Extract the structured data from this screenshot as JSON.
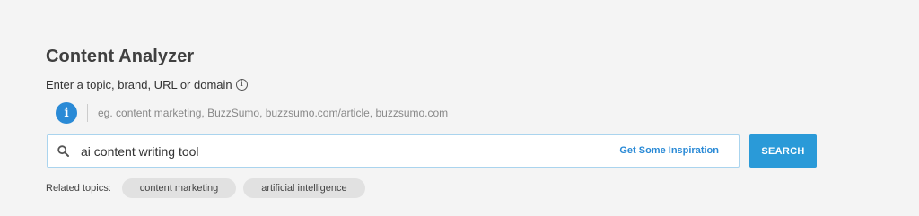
{
  "page": {
    "title": "Content Analyzer",
    "subtitle": "Enter a topic, brand, URL or domain",
    "subtitle_info_icon": "info-icon"
  },
  "hint": {
    "icon": "info-circle-icon",
    "text": "eg. content marketing, BuzzSumo, buzzsumo.com/article, buzzsumo.com"
  },
  "search": {
    "icon": "search-icon",
    "value": "ai content writing tool",
    "inspiration_link": "Get Some Inspiration",
    "button_label": "SEARCH"
  },
  "related": {
    "label": "Related topics:",
    "topics": [
      "content marketing",
      "artificial intelligence"
    ]
  },
  "colors": {
    "accent": "#2a8ad6",
    "button": "#2a9ad8",
    "background": "#f4f4f4",
    "chip": "#e1e1e1"
  }
}
